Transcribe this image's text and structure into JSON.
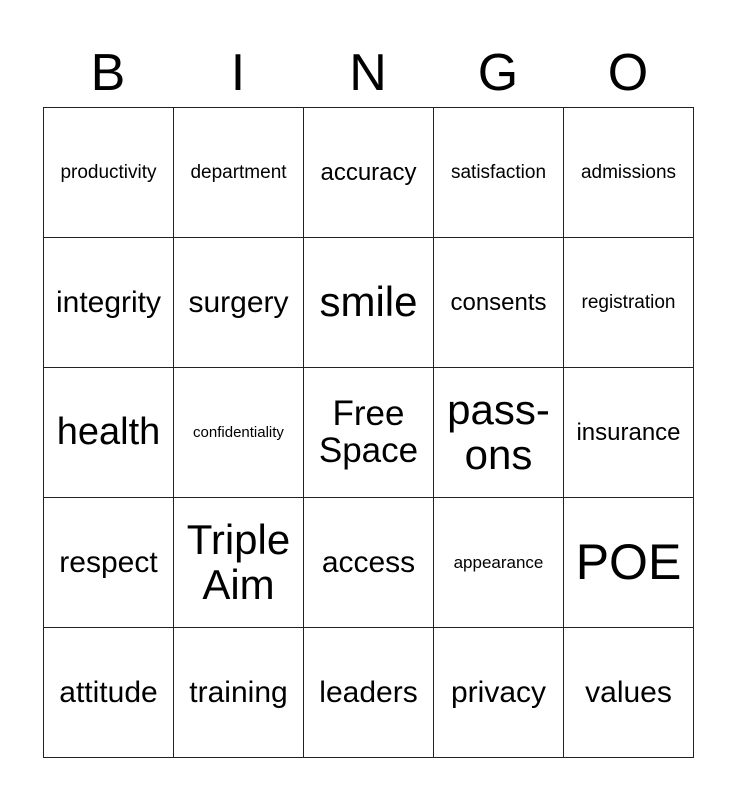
{
  "title_letters": [
    "B",
    "I",
    "N",
    "G",
    "O"
  ],
  "board": [
    [
      "productivity",
      "department",
      "accuracy",
      "satisfaction",
      "admissions"
    ],
    [
      "integrity",
      "surgery",
      "smile",
      "consents",
      "registration"
    ],
    [
      "health",
      "confidentiality",
      "Free Space",
      "pass-ons",
      "insurance"
    ],
    [
      "respect",
      "Triple Aim",
      "access",
      "appearance",
      "POE"
    ],
    [
      "attitude",
      "training",
      "leaders",
      "privacy",
      "values"
    ]
  ],
  "free_space_label": "Free Space"
}
